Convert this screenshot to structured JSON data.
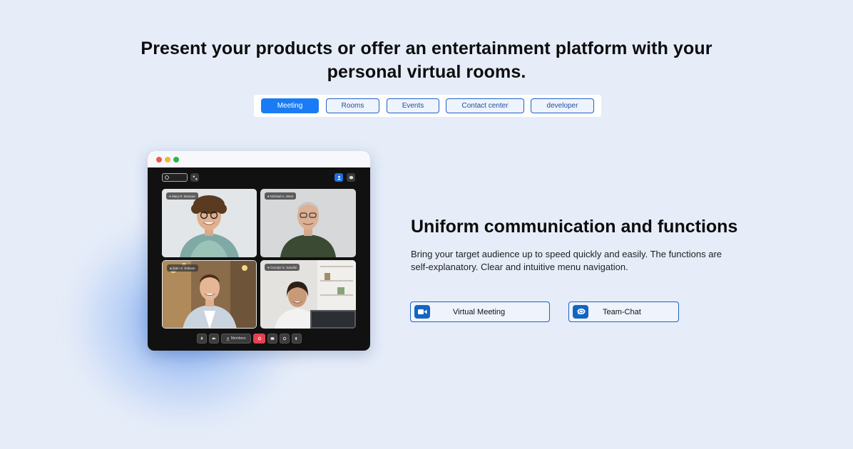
{
  "headline": {
    "line1": "Present your products or offer an entertainment platform with your",
    "line2": "personal virtual rooms."
  },
  "tabs": [
    {
      "label": "Meeting",
      "active": true
    },
    {
      "label": "Rooms",
      "active": false
    },
    {
      "label": "Events",
      "active": false
    },
    {
      "label": "Contact center",
      "active": false
    },
    {
      "label": "developer",
      "active": false
    }
  ],
  "mockup": {
    "participants": [
      {
        "name": "Mary R. Brunner"
      },
      {
        "name": "Michael A. West"
      },
      {
        "name": "John S. Erikson"
      },
      {
        "name": "Carolyn S. Sandlin"
      }
    ],
    "controls": {
      "members_label": "Members"
    }
  },
  "feature": {
    "title": "Uniform communication and functions",
    "description": "Bring your target audience up to speed quickly and easily. The functions are self-explanatory. Clear and intuitive menu navigation.",
    "buttons": [
      {
        "label": "Virtual Meeting",
        "icon": "video-camera-icon"
      },
      {
        "label": "Team-Chat",
        "icon": "chat-bubble-icon"
      }
    ]
  },
  "colors": {
    "background": "#e6edf9",
    "accent": "#1a7cf5",
    "border": "#1e62c7",
    "end_call": "#e54150"
  }
}
